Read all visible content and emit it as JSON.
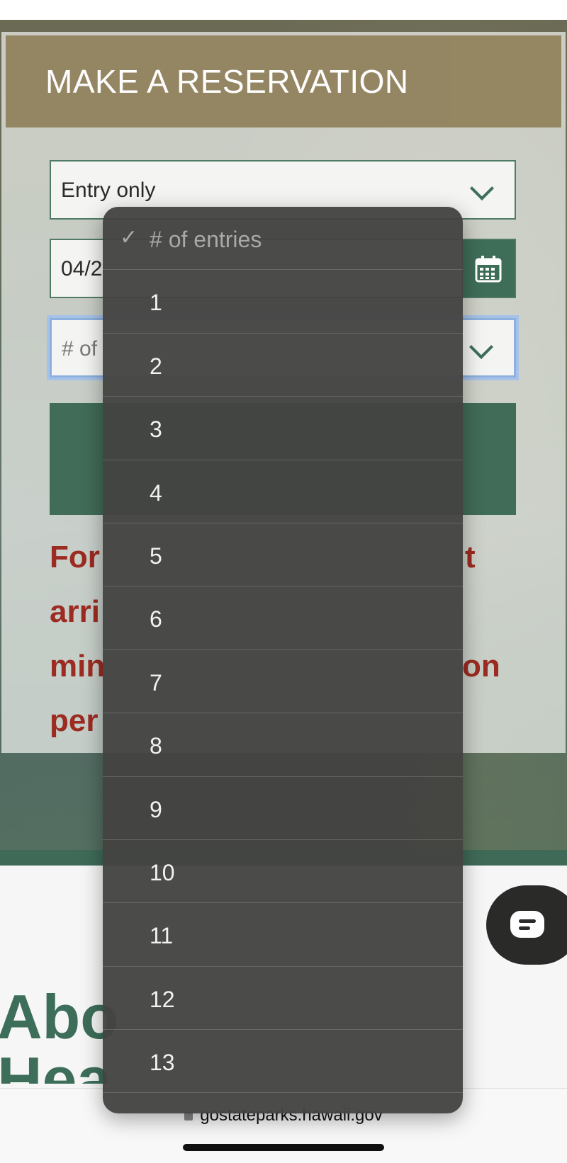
{
  "banner": {
    "title": "MAKE A RESERVATION"
  },
  "form": {
    "entry_type": "Entry only",
    "date_partial": "04/2",
    "count_partial": "# of"
  },
  "notice": {
    "lines": [
      "For",
      "arri",
      "min",
      "per"
    ],
    "right_fragments": [
      "t",
      "",
      "on",
      ""
    ]
  },
  "about": {
    "heading_line1": "Abo",
    "heading_line2": "Hea"
  },
  "dropdown": {
    "placeholder": "# of entries",
    "options": [
      "1",
      "2",
      "3",
      "4",
      "5",
      "6",
      "7",
      "8",
      "9",
      "10",
      "11",
      "12",
      "13"
    ]
  },
  "browser": {
    "url": "gostateparks.hawaii.gov"
  },
  "icons": {
    "calendar": "calendar-icon",
    "chevron": "chevron-down-icon",
    "chat": "chat-icon",
    "check": "checkmark-icon",
    "lock": "lock-icon"
  }
}
